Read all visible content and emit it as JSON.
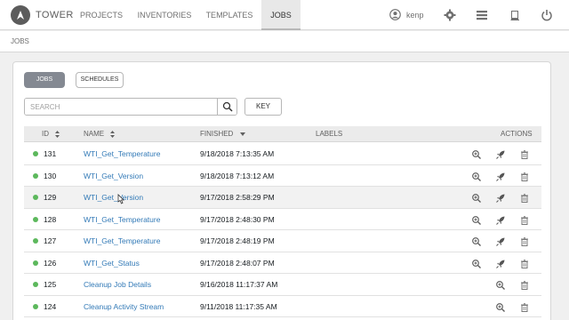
{
  "brand": "TOWER",
  "nav": [
    "PROJECTS",
    "INVENTORIES",
    "TEMPLATES",
    "JOBS"
  ],
  "user": {
    "name": "kenp"
  },
  "breadcrumb": "JOBS",
  "buttons": {
    "jobs": "JOBS",
    "schedules": "SCHEDULES",
    "key": "KEY"
  },
  "search": {
    "placeholder": "SEARCH"
  },
  "table": {
    "columns": {
      "id": "ID",
      "name": "NAME",
      "finished": "FINISHED",
      "labels": "LABELS",
      "actions": "ACTIONS"
    },
    "rows": [
      {
        "id": "131",
        "name": "WTI_Get_Temperature",
        "finished": "9/18/2018 7:13:35 AM",
        "status": "successful"
      },
      {
        "id": "130",
        "name": "WTI_Get_Version",
        "finished": "9/18/2018 7:13:12 AM",
        "status": "successful"
      },
      {
        "id": "129",
        "name": "WTI_Get_Version",
        "finished": "9/17/2018 2:58:29 PM",
        "status": "successful"
      },
      {
        "id": "128",
        "name": "WTI_Get_Temperature",
        "finished": "9/17/2018 2:48:30 PM",
        "status": "successful"
      },
      {
        "id": "127",
        "name": "WTI_Get_Temperature",
        "finished": "9/17/2018 2:48:19 PM",
        "status": "successful"
      },
      {
        "id": "126",
        "name": "WTI_Get_Status",
        "finished": "9/17/2018 2:48:07 PM",
        "status": "successful"
      },
      {
        "id": "125",
        "name": "Cleanup Job Details",
        "finished": "9/16/2018 11:17:37 AM",
        "status": "successful"
      },
      {
        "id": "124",
        "name": "Cleanup Activity Stream",
        "finished": "9/11/2018 11:17:35 AM",
        "status": "successful"
      }
    ]
  },
  "colors": {
    "success": "#5cb85c",
    "link": "#337ab7",
    "active_button": "#848992"
  }
}
